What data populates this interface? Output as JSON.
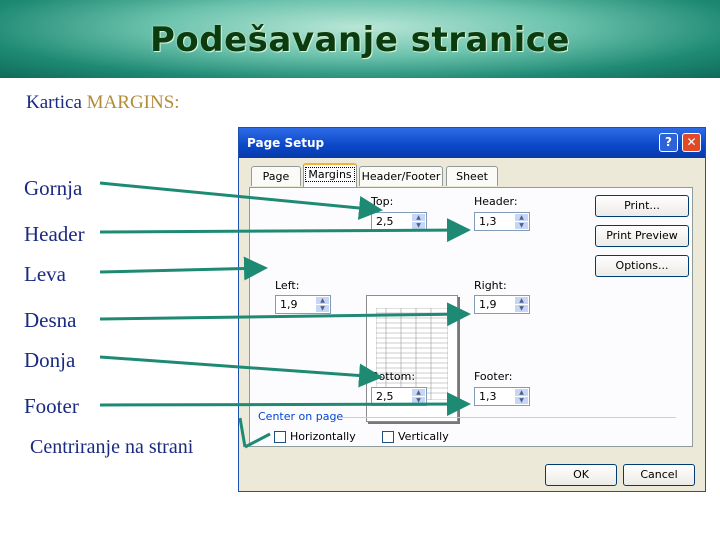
{
  "slide": {
    "title": "Podešavanje stranice",
    "subtitle_prefix": "Kartica ",
    "subtitle_accent": "MARGINS:",
    "labels": {
      "top": "Gornja",
      "header": "Header",
      "left": "Leva",
      "right": "Desna",
      "bottom": "Donja",
      "footer": "Footer",
      "center": "Centriranje na strani"
    }
  },
  "dialog": {
    "title": "Page Setup",
    "help_button": "?",
    "close_button": "✕",
    "tabs": [
      "Page",
      "Margins",
      "Header/Footer",
      "Sheet"
    ],
    "active_tab": "Margins",
    "fields": {
      "top": {
        "label": "Top:",
        "value": "2,5"
      },
      "header": {
        "label": "Header:",
        "value": "1,3"
      },
      "left": {
        "label": "Left:",
        "value": "1,9"
      },
      "right": {
        "label": "Right:",
        "value": "1,9"
      },
      "bottom": {
        "label": "Bottom:",
        "value": "2,5"
      },
      "footer": {
        "label": "Footer:",
        "value": "1,3"
      }
    },
    "center_group": {
      "label": "Center on page",
      "horizontally": "Horizontally",
      "vertically": "Vertically",
      "horizontally_checked": false,
      "vertically_checked": false
    },
    "buttons": {
      "print": "Print...",
      "print_preview": "Print Preview",
      "options": "Options...",
      "ok": "OK",
      "cancel": "Cancel"
    }
  },
  "colors": {
    "banner": "#1f8a74",
    "title_text": "#0b3c10",
    "label_text": "#1a2a80",
    "arrow": "#1f8a74",
    "dialog_titlebar": "#0a47c8"
  }
}
